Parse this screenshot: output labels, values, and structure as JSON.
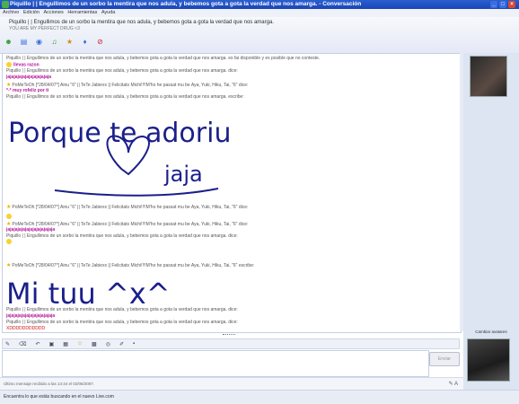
{
  "window": {
    "title": "Piquillo | | Engullimos de un sorbo la mentira que nos adula, y bebemos gota a gota la verdad que nos amarga.  -  Conversación"
  },
  "menu": [
    "Archivo",
    "Edición",
    "Acciones",
    "Herramientas",
    "Ayuda"
  ],
  "header": {
    "contact_name": "Piquillo | | Engullimos de un sorbo la mentira que nos adula, y bebemos gota a gota la verdad que nos amarga.",
    "contact_sub": "YOU ARE MY PERFECT DRUG <3"
  },
  "conversation": [
    {
      "text": "Piquillo | | Engullimos de un sorbo la mentira que nos adula, y bebemos gota a gota la verdad que nos amarga. es fai disponible y es posible que no conteste."
    },
    {
      "text": "llevas razon",
      "style": "pink"
    },
    {
      "text": "Piquillo | | Engullimos de un sorbo la mentira que nos adula, y bebemos gota a gota la verdad que nos amarga. dice:"
    },
    {
      "text": "jajajajajajajajajajajaja",
      "style": "pink"
    },
    {
      "text": "PoMeTeOh [*28/04/07*] Ainu \"6\" || TeTe Jabiexx || Felicitats Michi!!!!M'ho he passat mu be Aya, Yuki, Hiku, Tai, \"6\" dice:"
    },
    {
      "text": "*-* muy rofeliz por ti",
      "style": "pink"
    },
    {
      "text": "Piquillo | | Engullimos de un sorbo la mentira que nos adula, y bebemos gota a gota la verdad que nos amarga. escribe:"
    },
    {
      "text": "PoMeTeOh [*28/04/07*] Ainu \"6\" || TeTe Jabiexx || Felicitats Michi!!!!M'ho he passat mu be Aya, Yuki, Hiku, Tai, \"6\" dice:"
    },
    {
      "text": "PoMeTeOh [*28/04/07*] Ainu \"6\" || TeTe Jabiexx || Felicitats Michi!!!!M'ho he passat mu be Aya, Yuki, Hiku, Tai, \"6\" dice:"
    },
    {
      "text": "jajajajajajajajajajajajaja",
      "style": "pink"
    },
    {
      "text": "Piquillo | | Engullimos de un sorbo la mentira que nos adula, y bebemos gota a gota la verdad que nos amarga. dice:"
    },
    {
      "text": "PoMeTeOh [*28/04/07*] Ainu \"6\" || TeTe Jabiexx || Felicitats Michi!!!!M'ho he passat mu be Aya, Yuki, Hiku, Tai, \"6\" escribe:"
    },
    {
      "text": "Piquillo | | Engullimos de un sorbo la mentira que nos adula, y bebemos gota a gota la verdad que nos amarga. dice:"
    },
    {
      "text": "jajajajajajajajajajajajaja",
      "style": "pink"
    },
    {
      "text": "Piquillo | | Engullimos de un sorbo la mentira que nos adula, y bebemos gota a gota la verdad que nos amarga. dice:"
    },
    {
      "text": "XDDDDDDDDDDD",
      "style": "red"
    }
  ],
  "handwriting": {
    "line1": "Porque te adoriu",
    "line2": "jaja",
    "line3": "Mi tuu ^x^"
  },
  "sidebar": {
    "avatar_caption": "Cambiar avatares"
  },
  "input": {
    "send_label": "Enviar"
  },
  "status": {
    "last_message": "Último mensaje recibido a las 14:44 el 02/06/2007."
  },
  "ad": {
    "text": "Encuentra lo que estás buscando en el nuevo Live.com"
  },
  "colors": {
    "titlebar": "#1b44b8",
    "ink": "#1a1f8a",
    "pink": "#b5189b"
  }
}
